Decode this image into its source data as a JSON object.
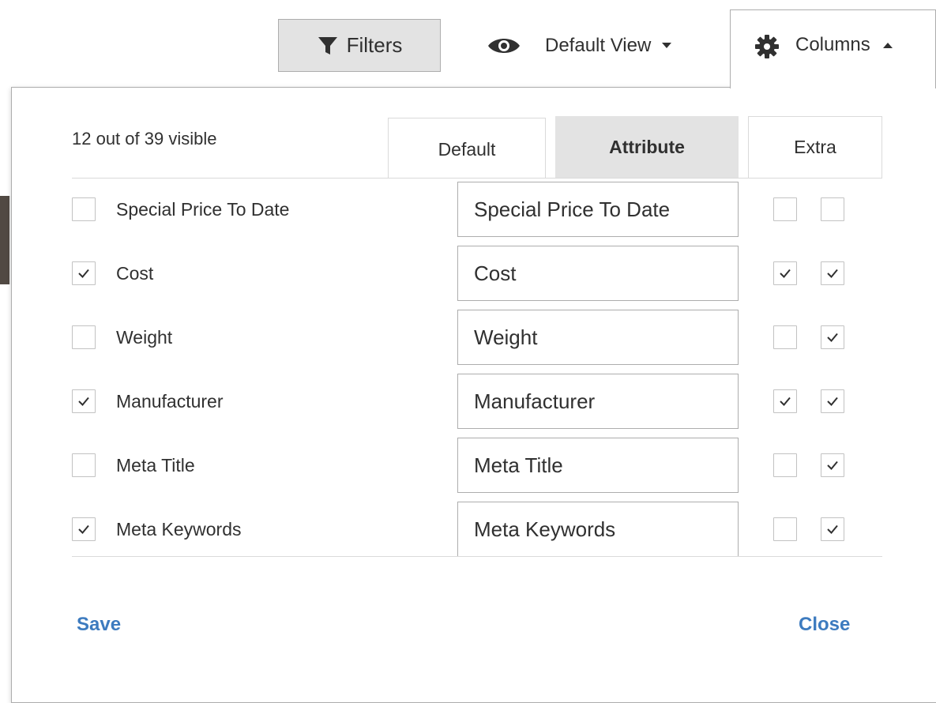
{
  "toolbar": {
    "filters_label": "Filters",
    "view_label": "Default View",
    "columns_label": "Columns"
  },
  "panel": {
    "visible_count": "12 out of 39 visible",
    "tabs": [
      {
        "label": "Default",
        "active": false
      },
      {
        "label": "Attribute",
        "active": true
      },
      {
        "label": "Extra",
        "active": false
      }
    ],
    "rows": [
      {
        "label": "Special Price To Date",
        "input_value": "Special Price To Date",
        "visible": false,
        "extra1": false,
        "extra2": false
      },
      {
        "label": "Cost",
        "input_value": "Cost",
        "visible": true,
        "extra1": true,
        "extra2": true
      },
      {
        "label": "Weight",
        "input_value": "Weight",
        "visible": false,
        "extra1": false,
        "extra2": true
      },
      {
        "label": "Manufacturer",
        "input_value": "Manufacturer",
        "visible": true,
        "extra1": true,
        "extra2": true
      },
      {
        "label": "Meta Title",
        "input_value": "Meta Title",
        "visible": false,
        "extra1": false,
        "extra2": true
      },
      {
        "label": "Meta Keywords",
        "input_value": "Meta Keywords",
        "visible": true,
        "extra1": false,
        "extra2": true
      }
    ],
    "save_label": "Save",
    "close_label": "Close"
  },
  "colors": {
    "link": "#3d7bbf",
    "active_tab_bg": "#e3e3e3",
    "button_bg": "#e3e3e3",
    "border": "#adadad"
  },
  "icons": {
    "filters": "funnel-icon",
    "view": "eye-icon",
    "columns": "gear-icon"
  }
}
